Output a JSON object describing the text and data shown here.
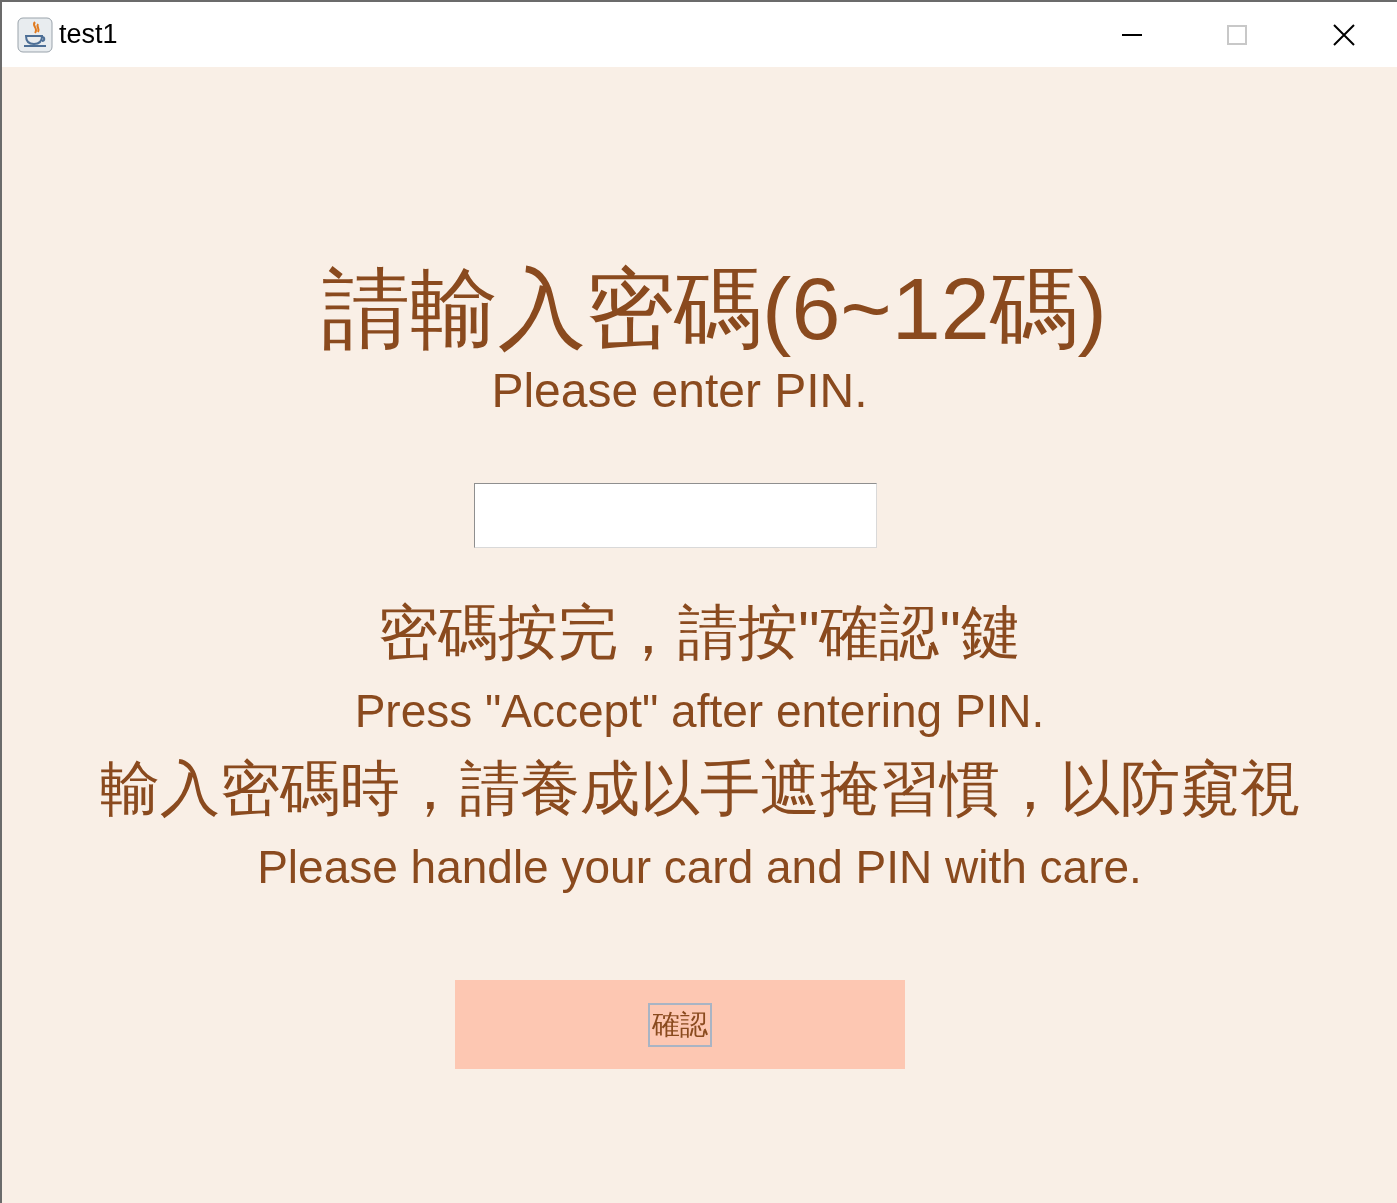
{
  "window": {
    "title": "test1"
  },
  "heading": "請輸入密碼(6~12碼)",
  "subheading": "Please enter PIN.",
  "instructions": [
    {
      "text": "密碼按完，請按\"確認\"鍵",
      "kind": "chinese"
    },
    {
      "text": "Press \"Accept\" after entering PIN.",
      "kind": "english"
    },
    {
      "text": "輸入密碼時，請養成以手遮掩習慣，以防窺視",
      "kind": "chinese"
    },
    {
      "text": "Please handle your card and PIN with care.",
      "kind": "english"
    }
  ],
  "confirm_button": {
    "label": "確認",
    "focused": true
  }
}
